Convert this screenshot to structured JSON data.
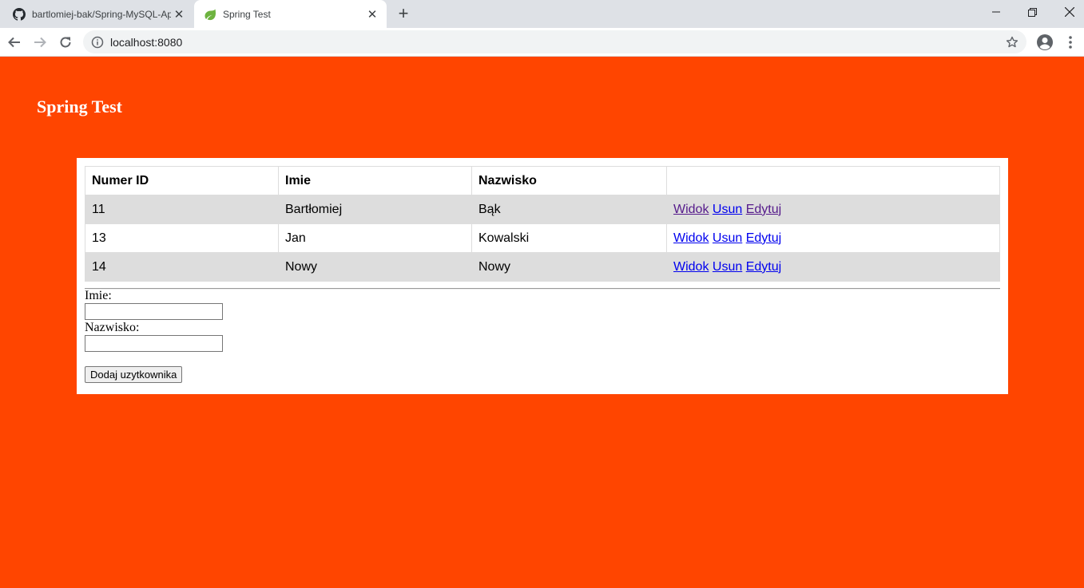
{
  "browser": {
    "tabs": [
      {
        "title": "bartlomiej-bak/Spring-MySQL-Ap",
        "icon": "github-icon",
        "active": false
      },
      {
        "title": "Spring Test",
        "icon": "spring-leaf-icon",
        "active": true
      }
    ],
    "url": "localhost:8080"
  },
  "page": {
    "title": "Spring Test",
    "background_color": "#ff4500",
    "table": {
      "headers": [
        "Numer ID",
        "Imie",
        "Nazwisko",
        ""
      ],
      "rows": [
        {
          "id": "11",
          "imie": "Bartłomiej",
          "nazwisko": "Bąk"
        },
        {
          "id": "13",
          "imie": "Jan",
          "nazwisko": "Kowalski"
        },
        {
          "id": "14",
          "imie": "Nowy",
          "nazwisko": "Nowy"
        }
      ],
      "actions": {
        "view": "Widok",
        "delete": "Usun",
        "edit": "Edytuj"
      }
    },
    "form": {
      "imie_label": "Imie:",
      "imie_value": "",
      "nazwisko_label": "Nazwisko:",
      "nazwisko_value": "",
      "submit_label": "Dodaj uzytkownika"
    }
  }
}
